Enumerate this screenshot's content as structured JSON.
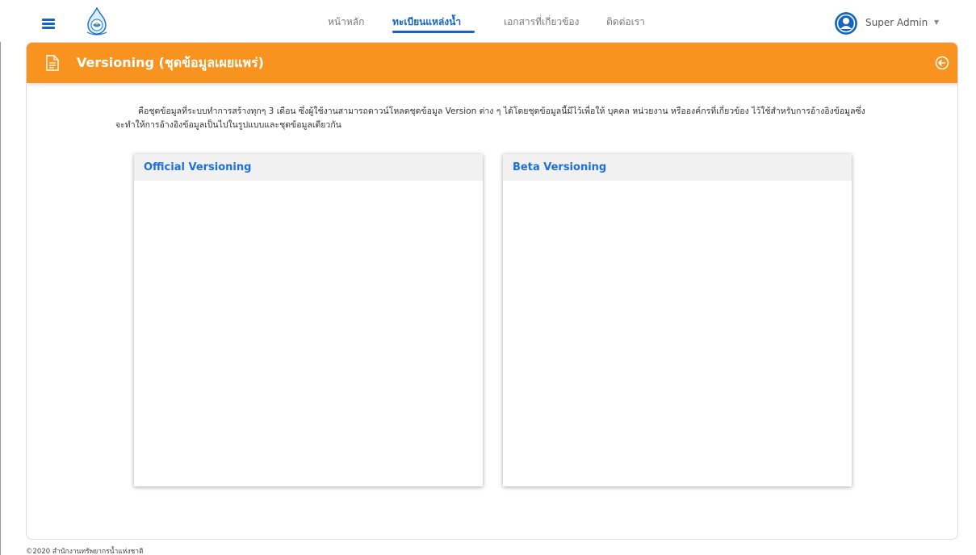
{
  "navbar": {
    "menu_icon": "hamburger-menu-icon",
    "logo_icon": "water-resources-emblem",
    "links": [
      {
        "label": "หน้าหลัก",
        "active": false
      },
      {
        "label": "ทะเบียนแหล่งน้ำ",
        "active": true
      },
      {
        "label": "เอกสารที่เกี่ยวข้อง",
        "active": false
      },
      {
        "label": "ติดต่อเรา",
        "active": false
      }
    ],
    "user": {
      "name": "Super Admin",
      "avatar_icon": "user-avatar-icon",
      "caret_icon": "caret-down-icon"
    },
    "accent_color": "#1565c0"
  },
  "page": {
    "title": "Versioning (ชุดข้อมูลเผยแพร่)",
    "header_color": "#f7931e",
    "title_icon": "document-icon",
    "back_icon": "circle-arrow-left-icon",
    "intro": "คือชุดข้อมูลที่ระบบทำการสร้างทุกๆ 3 เดือน ซึ่งผู้ใช้งานสามารถดาวน์โหลดชุดข้อมูล Version ต่าง ๆ ได้โดยชุดข้อมูลนี้มีไว้เพื่อให้ บุคคล หน่วยงาน หรือองค์กรที่เกี่ยวข้อง ไว้ใช้สำหรับการอ้างอิงข้อมูลซึ่งจะทำให้การอ้างอิงข้อมูลเป็นไปในรูปแบบและชุดข้อมูลเดียวกัน",
    "panels": [
      {
        "title": "Official Versioning"
      },
      {
        "title": "Beta Versioning"
      }
    ]
  },
  "footer": {
    "text": "©2020 สำนักงานทรัพยากรน้ำแห่งชาติ"
  }
}
